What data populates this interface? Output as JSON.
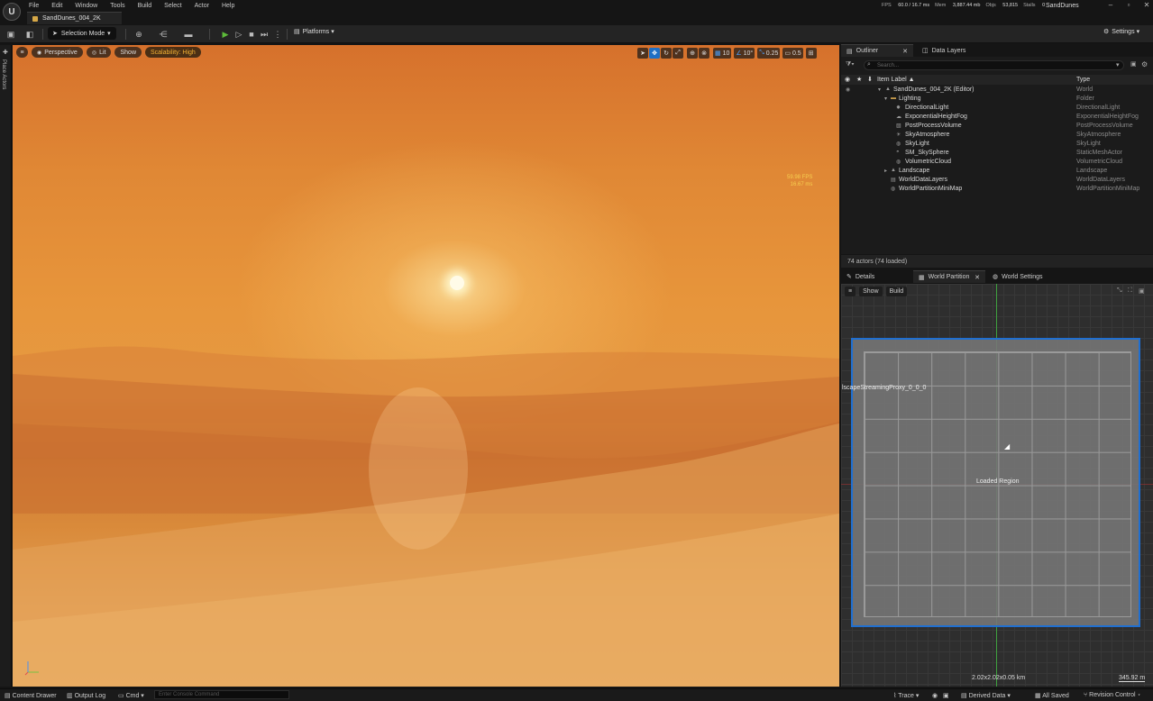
{
  "app": {
    "logo": "U",
    "menu": [
      "File",
      "Edit",
      "Window",
      "Tools",
      "Build",
      "Select",
      "Actor",
      "Help"
    ],
    "doc_tab": "SandDunes_004_2K",
    "project_name": "SandDunes",
    "stats": {
      "fps_label": "FPS",
      "fps_value": "60.0 / 16.7 ms",
      "mem_label": "Mem",
      "mem_value": "3,887.44 mb",
      "objs_label": "Objs",
      "objs_value": "53,815",
      "stalls_label": "Stalls",
      "stalls_value": "0"
    },
    "window_controls": [
      "–",
      "▫",
      "✕"
    ]
  },
  "toolbar": {
    "selection_mode": "Selection Mode",
    "platforms": "Platforms",
    "settings": "Settings"
  },
  "left_strip": {
    "place_actors": "Place Actors"
  },
  "viewport": {
    "perspective": "Perspective",
    "lit": "Lit",
    "show": "Show",
    "scalability": "Scalability: High",
    "grid_snap": "10",
    "rotation_snap": "10°",
    "scale_snap": "0.25",
    "camera_speed": "0.5",
    "fps_overlay": "59.98 FPS",
    "ms_overlay": "16.67 ms",
    "colors": {
      "accent": "#1e6fc5",
      "scalability": "#f2b134"
    }
  },
  "outliner": {
    "tab_outliner": "Outliner",
    "tab_data_layers": "Data Layers",
    "search_placeholder": "Search...",
    "col_label": "Item Label ▲",
    "col_type": "Type",
    "rows": [
      {
        "label": "SandDunes_004_2K (Editor)",
        "type": "World"
      },
      {
        "label": "Lighting",
        "type": "Folder"
      },
      {
        "label": "DirectionalLight",
        "type": "DirectionalLight"
      },
      {
        "label": "ExponentialHeightFog",
        "type": "ExponentialHeightFog"
      },
      {
        "label": "PostProcessVolume",
        "type": "PostProcessVolume"
      },
      {
        "label": "SkyAtmosphere",
        "type": "SkyAtmosphere"
      },
      {
        "label": "SkyLight",
        "type": "SkyLight"
      },
      {
        "label": "SM_SkySphere",
        "type": "StaticMeshActor"
      },
      {
        "label": "VolumetricCloud",
        "type": "VolumetricCloud"
      },
      {
        "label": "Landscape",
        "type": "Landscape"
      },
      {
        "label": "WorldDataLayers",
        "type": "WorldDataLayers"
      },
      {
        "label": "WorldPartitionMiniMap",
        "type": "WorldPartitionMiniMap"
      }
    ],
    "footer": "74 actors (74 loaded)"
  },
  "details": {
    "tab_details": "Details",
    "tab_world_partition": "World Partition",
    "tab_world_settings": "World Settings",
    "show": "Show",
    "build": "Build",
    "proxy_label": "lscapeStreamingProxy_0_0_0",
    "loaded_region": "Loaded Region",
    "size": "2.02x2.02x0.05 km",
    "scale": "345.92 m"
  },
  "statusbar": {
    "content_drawer": "Content Drawer",
    "output_log": "Output Log",
    "cmd": "Cmd",
    "console_placeholder": "Enter Console Command",
    "trace": "Trace",
    "derived_data": "Derived Data",
    "all_saved": "All Saved",
    "revision_control": "Revision Control"
  }
}
